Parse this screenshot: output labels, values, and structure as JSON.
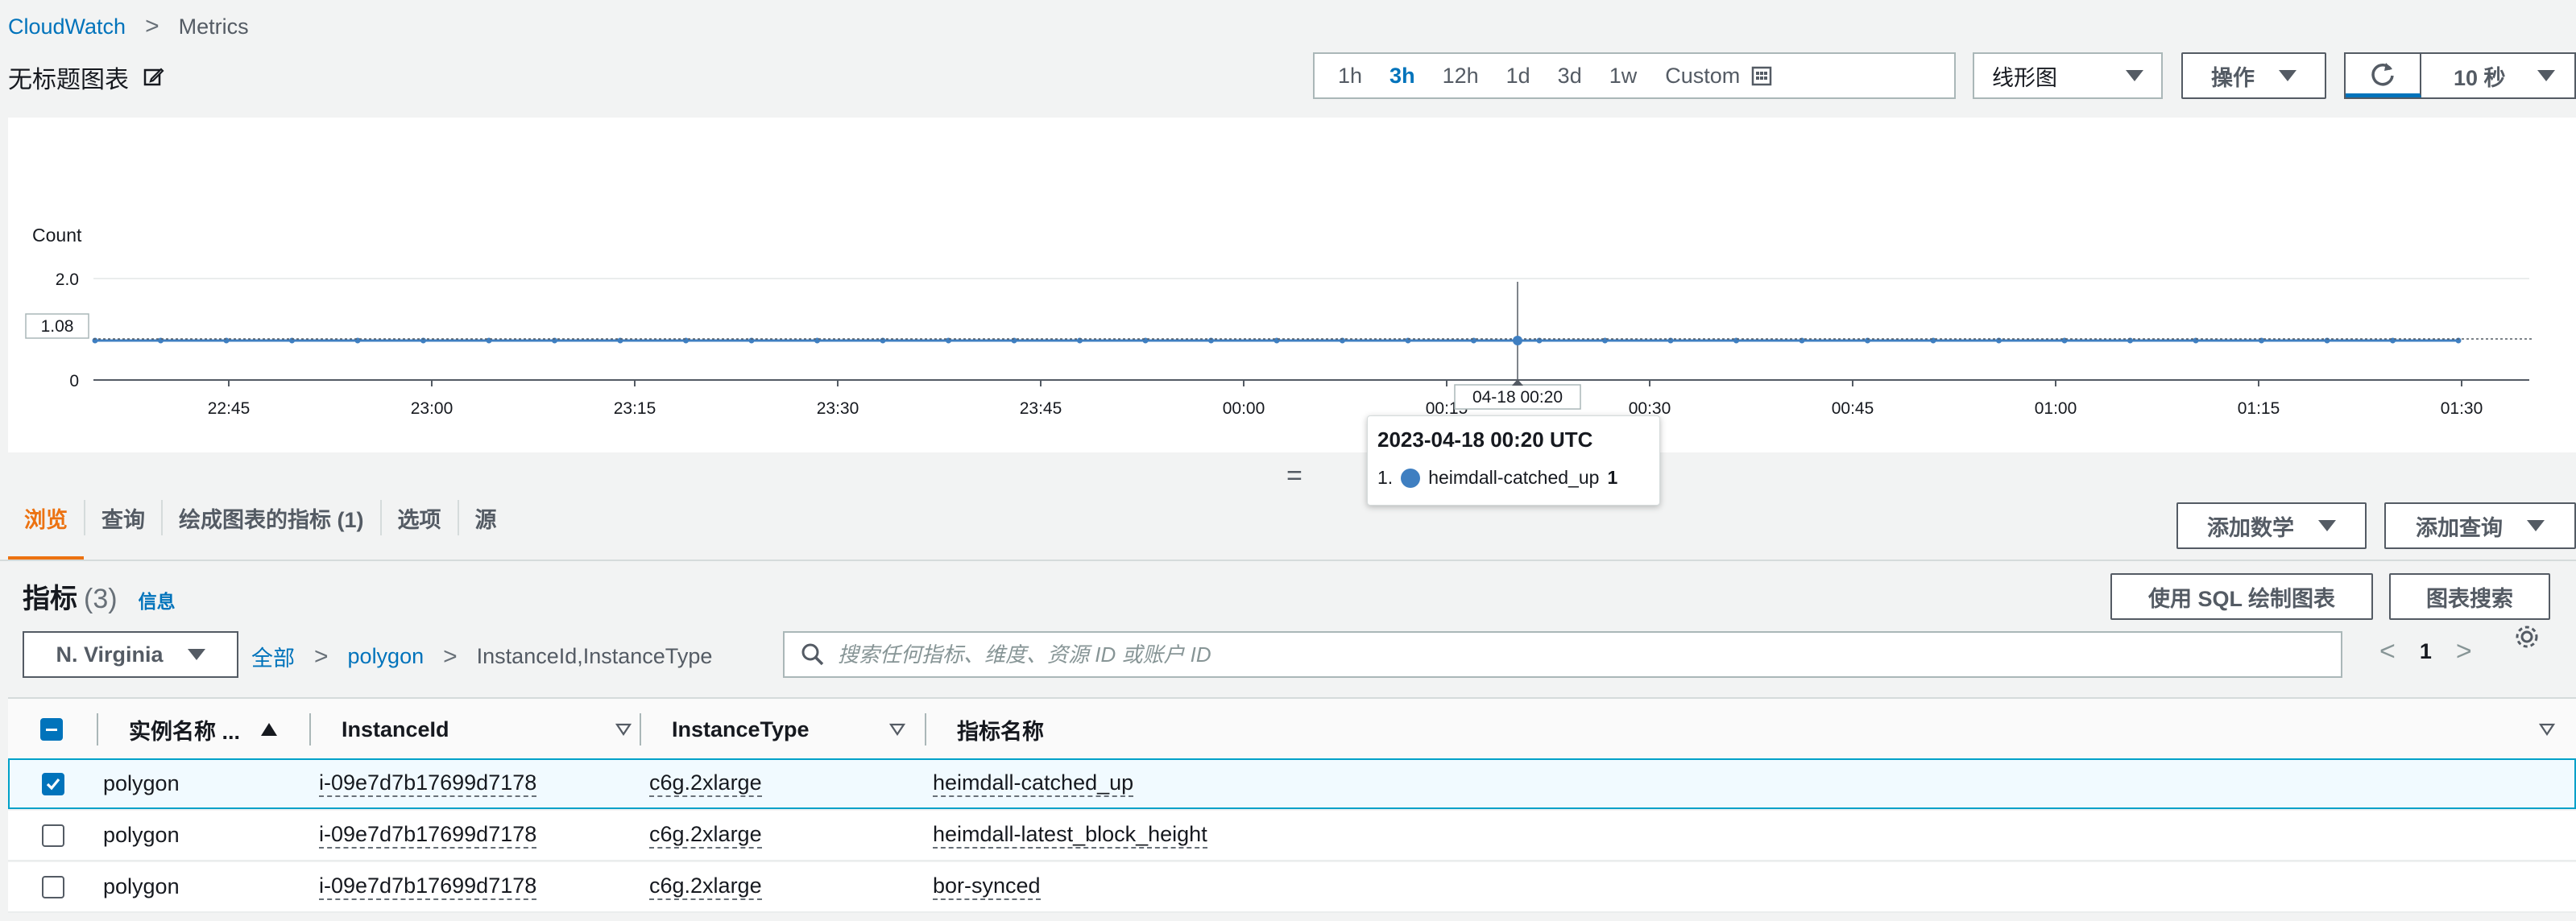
{
  "breadcrumb": {
    "service": "CloudWatch",
    "current": "Metrics"
  },
  "graph_title": "无标题图表",
  "time_range": {
    "options": [
      "1h",
      "3h",
      "12h",
      "1d",
      "3d",
      "1w"
    ],
    "active": "3h",
    "custom_label": "Custom"
  },
  "chart_type_select": "线形图",
  "actions_label": "操作",
  "refresh_interval": "10 秒",
  "chart_data": {
    "type": "line",
    "ylabel": "Count",
    "y_ticks": [
      "2.0",
      "0"
    ],
    "ylim": [
      0,
      2.0
    ],
    "hover_y_label": "1.08",
    "x_ticks": [
      "22:45",
      "23:00",
      "23:15",
      "23:30",
      "23:45",
      "00:00",
      "00:15",
      "00:30",
      "00:45",
      "01:00",
      "01:15",
      "01:30"
    ],
    "hover_x_label": "04-18 00:20",
    "series": [
      {
        "name": "heimdall-catched_up",
        "color": "#3f7fc1",
        "values": [
          1,
          1,
          1,
          1,
          1,
          1,
          1,
          1,
          1,
          1,
          1,
          1,
          1,
          1,
          1,
          1,
          1,
          1,
          1,
          1,
          1,
          1,
          1,
          1,
          1,
          1,
          1,
          1,
          1,
          1,
          1,
          1,
          1,
          1,
          1,
          1,
          1
        ]
      }
    ],
    "x_range": [
      "22:30",
      "01:30"
    ]
  },
  "tooltip": {
    "title": "2023-04-18 00:20 UTC",
    "index": "1.",
    "series_name": "heimdall-catched_up",
    "value": "1"
  },
  "tabs": [
    "浏览",
    "查询",
    "绘成图表的指标 (1)",
    "选项",
    "源"
  ],
  "tab_active": "浏览",
  "add_math_label": "添加数学",
  "add_query_label": "添加查询",
  "metrics": {
    "title": "指标",
    "count": "(3)",
    "info": "信息"
  },
  "sql_button": "使用 SQL 绘制图表",
  "graph_search_button": "图表搜索",
  "region": "N. Virginia",
  "path": {
    "all": "全部",
    "namespace": "polygon",
    "dimensions": "InstanceId,InstanceType"
  },
  "search_placeholder": "搜索任何指标、维度、资源 ID 或账户 ID",
  "pagination": {
    "page": "1"
  },
  "table": {
    "headers": [
      "实例名称 ...",
      "InstanceId",
      "InstanceType",
      "指标名称"
    ],
    "rows": [
      {
        "name": "polygon",
        "instance_id": "i-09e7d7b17699d7178",
        "instance_type": "c6g.2xlarge",
        "metric": "heimdall-catched_up",
        "checked": true
      },
      {
        "name": "polygon",
        "instance_id": "i-09e7d7b17699d7178",
        "instance_type": "c6g.2xlarge",
        "metric": "heimdall-latest_block_height",
        "checked": false
      },
      {
        "name": "polygon",
        "instance_id": "i-09e7d7b17699d7178",
        "instance_type": "c6g.2xlarge",
        "metric": "bor-synced",
        "checked": false
      }
    ]
  },
  "colors": {
    "link": "#0073bb",
    "active_tab": "#ec7211",
    "series": "#3f7fc1",
    "selected_row": "#f1faff"
  }
}
